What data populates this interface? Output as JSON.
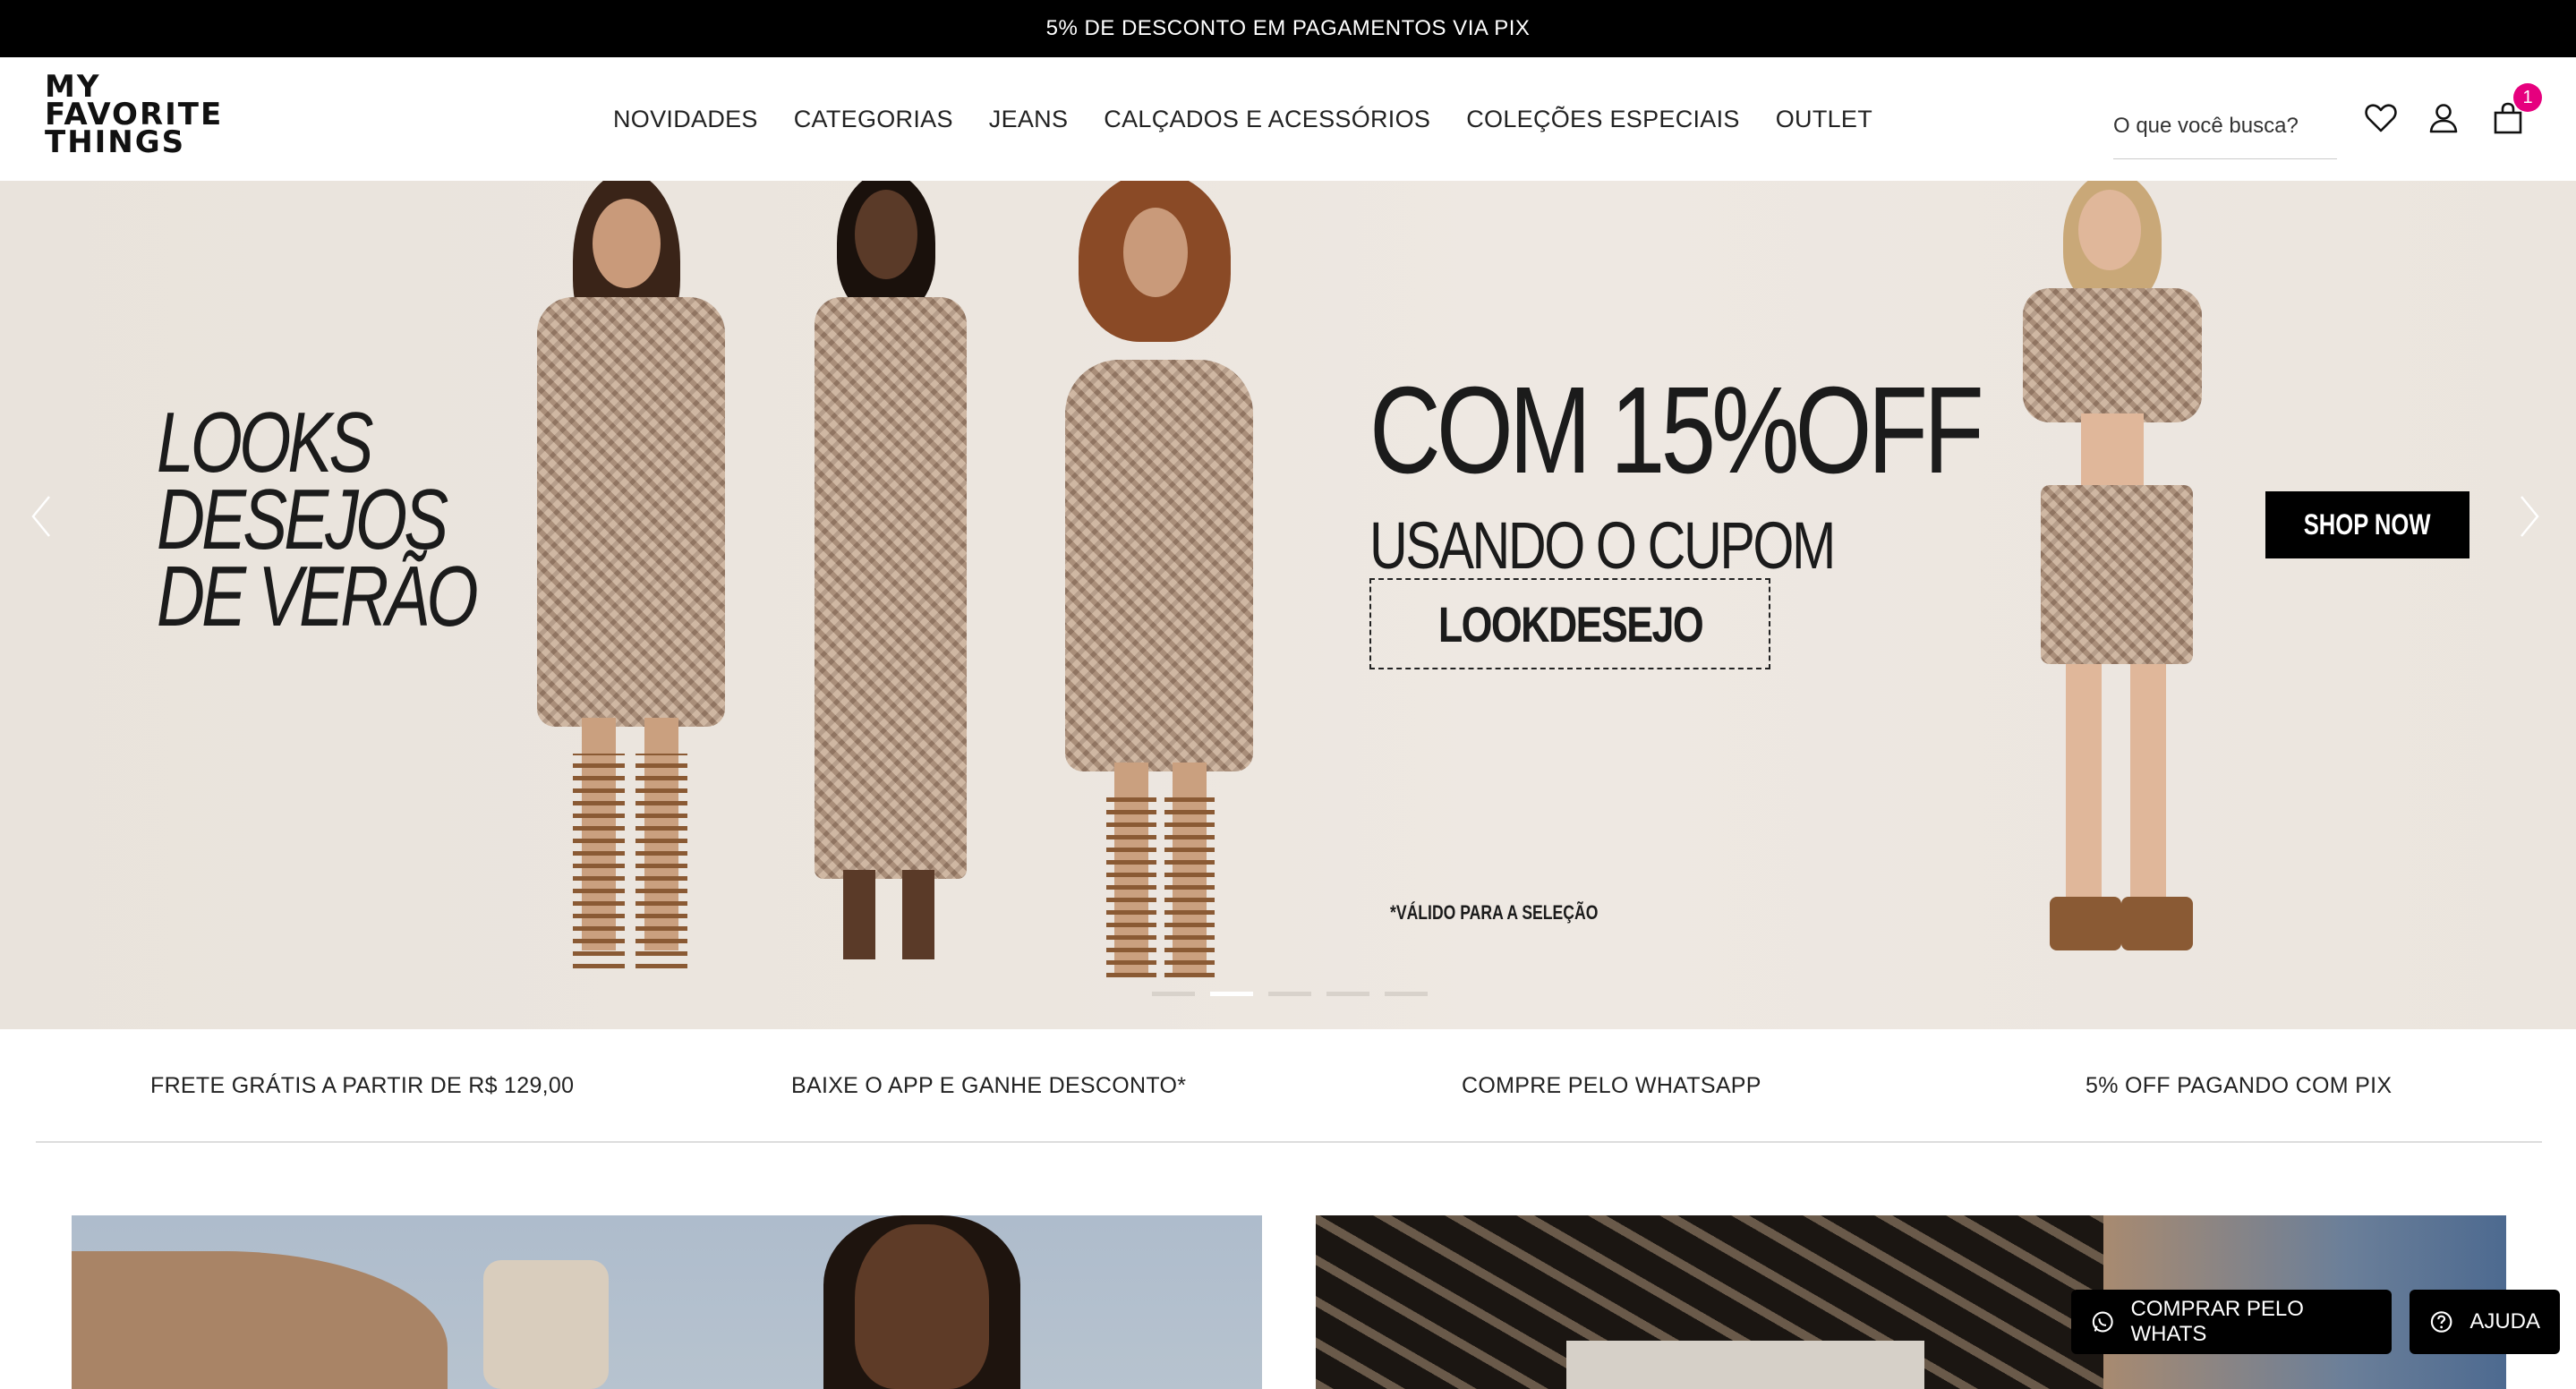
{
  "announcement": {
    "text": "5% DE DESCONTO EM PAGAMENTOS VIA PIX"
  },
  "header": {
    "logo_lines": [
      "MY",
      "FAVORITE",
      "THINGS"
    ],
    "nav": [
      "NOVIDADES",
      "CATEGORIAS",
      "JEANS",
      "CALÇADOS E ACESSÓRIOS",
      "COLEÇÕES ESPECIAIS",
      "OUTLET"
    ],
    "search_placeholder": "O que você busca?",
    "icons": [
      "heart-icon",
      "user-icon",
      "bag-icon"
    ],
    "cart_count": "1",
    "badge_color": "#e6007e"
  },
  "hero": {
    "left_lines": [
      "LOOKS",
      "DESEJOS",
      "DE VERÃO"
    ],
    "headline": "COM 15%OFF",
    "subheadline": "USANDO O CUPOM",
    "coupon_code": "LOOKDESEJO",
    "disclaimer": "*VÁLIDO PARA A SELEÇÃO",
    "cta": "SHOP NOW",
    "slide_count": 5,
    "active_slide": 2
  },
  "benefits": [
    "FRETE GRÁTIS A PARTIR DE R$ 129,00",
    "BAIXE O APP E GANHE DESCONTO*",
    "COMPRE PELO WHATSAPP",
    "5% OFF PAGANDO COM PIX"
  ],
  "floating": {
    "whats_label": "COMPRAR PELO WHATS",
    "help_label": "AJUDA"
  }
}
